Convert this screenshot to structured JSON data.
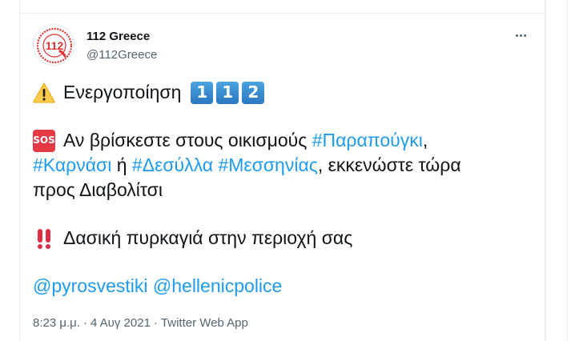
{
  "author": {
    "name": "112 Greece",
    "handle": "@112Greece",
    "avatar_text": "112"
  },
  "tweet": {
    "line1_text": "Ενεργοποίηση",
    "keycaps": [
      "1",
      "1",
      "2"
    ],
    "sos_label": "SOS",
    "line2_text": "Αν βρίσκεστε στους οικισμούς",
    "hashtag_1": "#Παραπούγκι",
    "line2_comma": ",",
    "hashtag_2": "#Καρνάσι",
    "line3_or": "ή",
    "hashtag_3": "#Δεσύλλα",
    "hashtag_4": "#Μεσσηνίας",
    "line3_rest": ", εκκενώστε τώρα",
    "line4_text": "προς Διαβολίτσι",
    "line5_text": "Δασική πυρκαγιά στην περιοχή σας",
    "mention_1": "@pyrosvestiki",
    "mention_2": "@hellenicpolice"
  },
  "meta": {
    "time": "8:23 μ.μ.",
    "date": "4 Αυγ 2021",
    "source": "Twitter Web App",
    "separator": "·"
  },
  "icons": {
    "warning": "warning-icon",
    "sos": "sos-icon",
    "double_exclamation": "double-exclamation-icon",
    "more": "more-icon"
  },
  "colors": {
    "link": "#1d9bf0",
    "secondary_text": "#536471",
    "avatar_red": "#e03030"
  }
}
